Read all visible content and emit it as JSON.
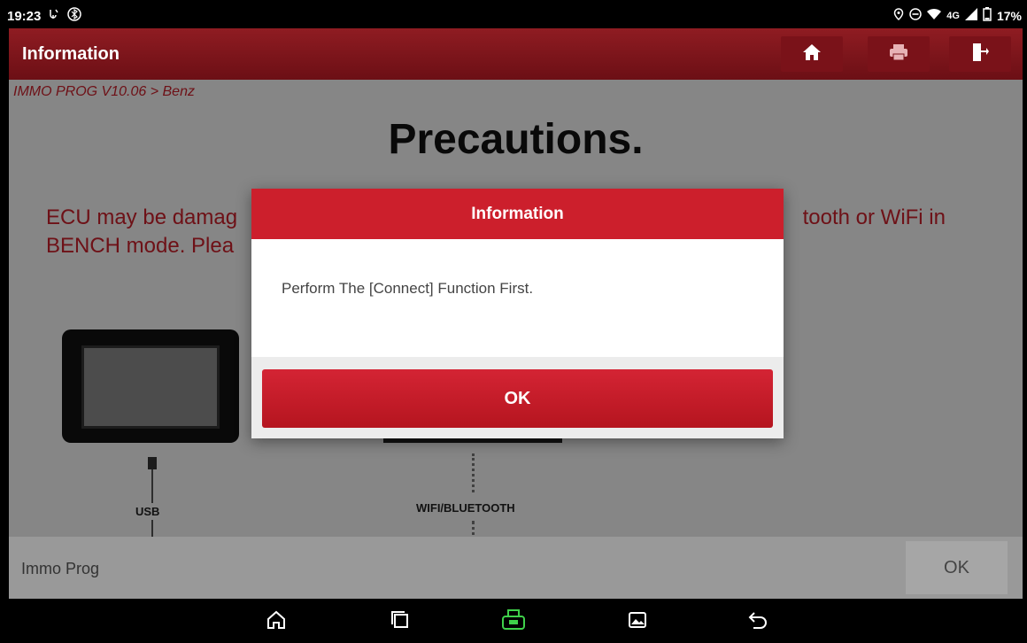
{
  "status_bar": {
    "time": "19:23",
    "network": "4G",
    "battery": "17%"
  },
  "titlebar": {
    "title": "Information"
  },
  "content": {
    "breadcrumb": "IMMO PROG V10.06 > Benz",
    "heading": "Precautions.",
    "warning_left_line1": "ECU may be damag",
    "warning_right_line1": "tooth or WiFi in",
    "warning_left_line2": "BENCH mode. Plea",
    "usb_label": "USB",
    "wifi_label": "WIFI/BLUETOOTH"
  },
  "dialog": {
    "title": "Information",
    "message": "Perform The [Connect] Function First.",
    "ok_label": "OK"
  },
  "bottom_bar": {
    "label": "Immo Prog",
    "ok_label": "OK"
  },
  "colors": {
    "brand_red": "#cc1f2c",
    "title_dark_red": "#7a1219"
  },
  "icons": [
    "home-icon",
    "print-icon",
    "exit-icon",
    "nav-home-icon",
    "recent-apps-icon",
    "vci-icon",
    "gallery-icon",
    "back-icon"
  ]
}
